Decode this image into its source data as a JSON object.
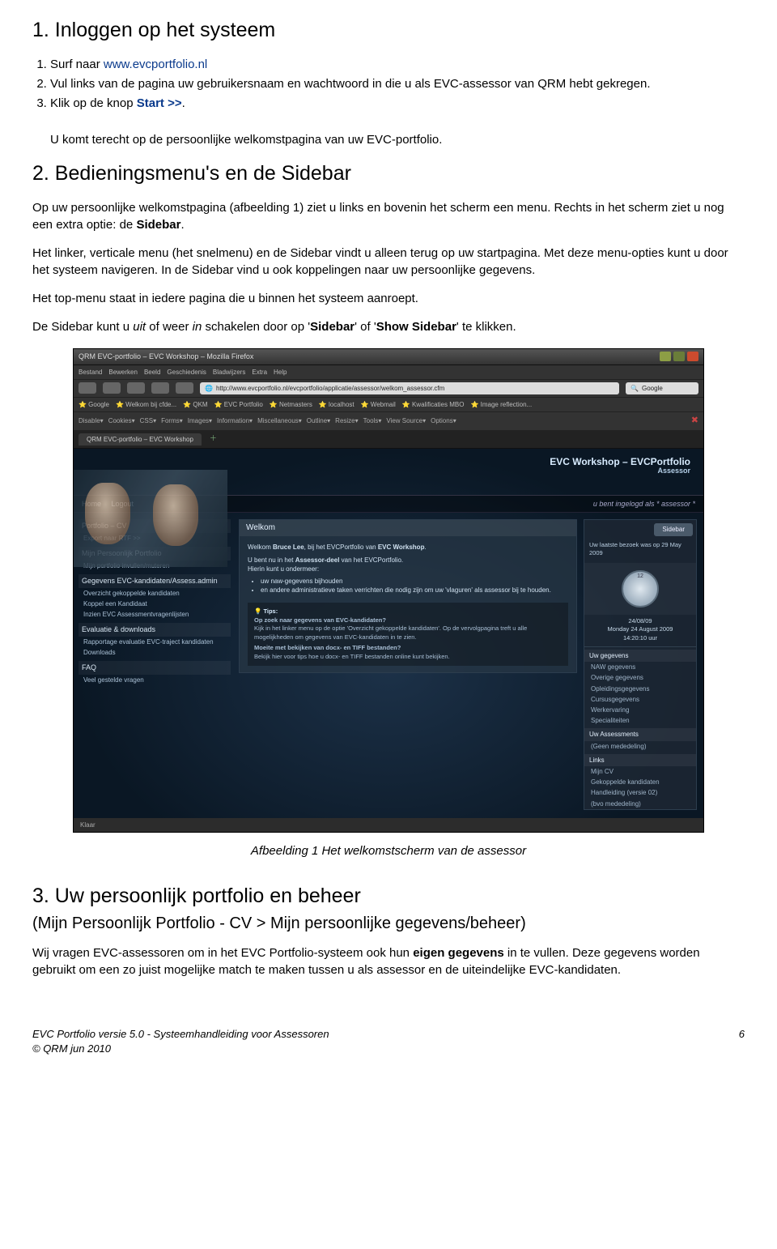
{
  "section1": {
    "title": "1. Inloggen op het systeem",
    "steps": [
      {
        "n": "1.",
        "pre": "Surf naar ",
        "link": "www.evcportfolio.nl"
      },
      {
        "n": "2.",
        "text": "Vul links van de pagina uw gebruikersnaam en wachtwoord in die u als EVC-assessor van QRM hebt gekregen."
      },
      {
        "n": "3.",
        "pre": "Klik op de knop ",
        "btn": "Start >>",
        "post": "."
      }
    ],
    "after": "U komt terecht op de persoonlijke welkomstpagina van uw EVC-portfolio."
  },
  "section2": {
    "title": "2. Bedieningsmenu's en de Sidebar",
    "p1a": "Op uw persoonlijke welkomstpagina (afbeelding 1) ziet u links en bovenin het scherm een menu. Rechts in het scherm ziet u nog een extra optie: de ",
    "p1b": "Sidebar",
    "p1c": ".",
    "p2": "Het linker, verticale menu (het snelmenu) en de Sidebar vindt u alleen terug op uw startpagina. Met deze menu-opties kunt u door het systeem navigeren. In de Sidebar vind u ook koppelingen naar uw persoonlijke gegevens.",
    "p3": "Het  top-menu staat in iedere pagina die u binnen het systeem aanroept.",
    "p4a": "De Sidebar kunt u ",
    "p4b": "uit",
    "p4c": " of weer ",
    "p4d": "in",
    "p4e": " schakelen door op '",
    "p4f": "Sidebar",
    "p4g": "' of  '",
    "p4h": "Show Sidebar",
    "p4i": "' te klikken."
  },
  "screenshot": {
    "windowTitle": "QRM EVC-portfolio – EVC Workshop – Mozilla Firefox",
    "menus": [
      "Bestand",
      "Bewerken",
      "Beeld",
      "Geschiedenis",
      "Bladwijzers",
      "Extra",
      "Help"
    ],
    "url": "http://www.evcportfolio.nl/evcportfolio/applicatie/assessor/welkom_assessor.cfm",
    "searchEngine": "Google",
    "bookmarks": [
      "Google",
      "Welkom bij cfde...",
      "QKM",
      "EVC Portfolio",
      "Netmasters",
      "localhost",
      "Webmail",
      "Kwalificaties MBO",
      "Image reflection..."
    ],
    "devtools": [
      "Disable",
      "Cookies",
      "CSS",
      "Forms",
      "Images",
      "Information",
      "Miscellaneous",
      "Outline",
      "Resize",
      "Tools",
      "View Source",
      "Options"
    ],
    "tab": "QRM EVC-portfolio – EVC Workshop",
    "appTitle": "EVC Workshop – EVCPortfolio",
    "appRole": "Assessor",
    "topnav": {
      "home": "Home",
      "logout": "Logout",
      "right": "u bent ingelogd als * assessor *"
    },
    "snelmenu": [
      {
        "head": "Portfolio – CV",
        "items": [
          "Export naar RTF >>"
        ]
      },
      {
        "head": "Mijn Persoonlijk Portfolio",
        "items": [
          "Mijn portfolio invullen/muteren"
        ]
      },
      {
        "head": "Gegevens EVC-kandidaten/Assess.admin",
        "items": [
          "Overzicht gekoppelde kandidaten",
          "Koppel een Kandidaat",
          "Inzien EVC Assessmentvragenlijsten"
        ]
      },
      {
        "head": "Evaluatie & downloads",
        "items": [
          "Rapportage evaluatie EVC-traject kandidaten",
          "Downloads"
        ]
      },
      {
        "head": "FAQ",
        "items": [
          "Veel gestelde vragen"
        ]
      }
    ],
    "welkom": {
      "title": "Welkom",
      "line1a": "Welkom ",
      "line1b": "Bruce  Lee",
      "line1c": ", bij het EVCPortfolio van ",
      "line1d": "EVC Workshop",
      "line1e": ".",
      "line2a": "U bent nu in het ",
      "line2b": "Assessor-deel",
      "line2c": " van het EVCPortfolio.",
      "line3": "Hierin kunt u ondermeer:",
      "bullets": [
        "uw naw-gegevens bijhouden",
        "en andere administratieve taken verrichten die nodig zijn om uw 'vlaguren' als assessor bij te houden."
      ],
      "tipsHead": "Tips:",
      "tip1h": "Op zoek naar gegevens van EVC-kandidaten?",
      "tip1": "Kijk in het linker menu op de optie 'Overzicht gekoppelde kandidaten'. Op de vervolgpagina treft u alle mogelijkheden om gegevens van EVC-kandidaten in te zien.",
      "tip2h": "Moeite met bekijken van docx- en TIFF bestanden?",
      "tip2": "Bekijk hier voor tips hoe u docx- en TIFF bestanden online kunt bekijken."
    },
    "sidebar": {
      "btn": "Sidebar",
      "lastVisit": "Uw laatste bezoek was op 29 May 2009",
      "clockNum": "12",
      "date1": "24/08/09",
      "date2": "Monday 24 August 2009",
      "date3": "14:20:10 uur",
      "blocks": [
        {
          "head": "Uw gegevens",
          "items": [
            "NAW gegevens",
            "Overige gegevens",
            "Opleidingsgegevens",
            "Cursusgegevens",
            "Werkervaring",
            "Specialiteiten"
          ]
        },
        {
          "head": "Uw Assessments",
          "items": [
            "(Geen mededeling)"
          ]
        },
        {
          "head": "Links",
          "items": [
            "Mijn CV",
            "Gekoppelde kandidaten",
            "Handleiding (versie 02)",
            "(bvo mededeling)"
          ]
        }
      ]
    },
    "status": "Klaar"
  },
  "caption": "Afbeelding 1 Het welkomstscherm van de assessor",
  "section3": {
    "title": "3. Uw persoonlijk portfolio en beheer",
    "sub": "(Mijn Persoonlijk Portfolio - CV > Mijn persoonlijke gegevens/beheer)",
    "p1a": "Wij vragen EVC-assessoren om in het EVC Portfolio-systeem ook hun ",
    "p1b": "eigen gegevens",
    "p1c": " in te vullen. Deze gegevens worden gebruikt om een zo juist mogelijke match te maken tussen u als assessor en de uiteindelijke EVC-kandidaten."
  },
  "footer": {
    "left1": "EVC Portfolio versie 5.0 - Systeemhandleiding voor Assessoren",
    "left2": "© QRM jun 2010",
    "page": "6"
  }
}
